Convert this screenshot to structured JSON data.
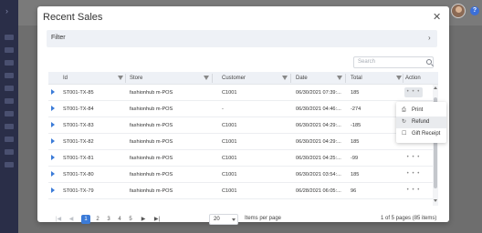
{
  "modal": {
    "title": "Recent Sales",
    "close_icon": "close-icon",
    "filter_label": "Filter",
    "search_placeholder": "Search"
  },
  "columns": [
    {
      "key": "id",
      "label": "Id"
    },
    {
      "key": "store",
      "label": "Store"
    },
    {
      "key": "customer",
      "label": "Customer"
    },
    {
      "key": "date",
      "label": "Date"
    },
    {
      "key": "total",
      "label": "Total"
    },
    {
      "key": "action",
      "label": "Action"
    }
  ],
  "rows": [
    {
      "id": "ST001-TX-85",
      "store": "fashionhub m-POS",
      "customer": "C1001",
      "date": "06/30/2021 07:39:...",
      "total": "185",
      "action": "• • •"
    },
    {
      "id": "ST001-TX-84",
      "store": "fashionhub m-POS",
      "customer": "-",
      "date": "06/30/2021 04:46:...",
      "total": "-274",
      "action": "• • •"
    },
    {
      "id": "ST001-TX-83",
      "store": "fashionhub m-POS",
      "customer": "C1001",
      "date": "06/30/2021 04:29:...",
      "total": "-185",
      "action": "• • •"
    },
    {
      "id": "ST001-TX-82",
      "store": "fashionhub m-POS",
      "customer": "C1001",
      "date": "06/30/2021 04:29:...",
      "total": "185",
      "action": "• • •"
    },
    {
      "id": "ST001-TX-81",
      "store": "fashionhub m-POS",
      "customer": "C1001",
      "date": "06/30/2021 04:25:...",
      "total": "-99",
      "action": "• • •"
    },
    {
      "id": "ST001-TX-80",
      "store": "fashionhub m-POS",
      "customer": "C1001",
      "date": "06/30/2021 03:54:...",
      "total": "185",
      "action": "• • •"
    },
    {
      "id": "ST001-TX-79",
      "store": "fashionhub m-POS",
      "customer": "C1001",
      "date": "06/28/2021 06:05:...",
      "total": "96",
      "action": "• • •"
    }
  ],
  "action_menu": [
    {
      "icon": "print-icon",
      "glyph": "⎙",
      "label": "Print"
    },
    {
      "icon": "refund-icon",
      "glyph": "↻",
      "label": "Refund"
    },
    {
      "icon": "gift-receipt-icon",
      "glyph": "☐",
      "label": "Gift Receipt"
    }
  ],
  "pager": {
    "first": "|◀",
    "prev": "◀",
    "pages": [
      "1",
      "2",
      "3",
      "4",
      "5"
    ],
    "current_page": "1",
    "next": "▶",
    "last": "▶|",
    "page_size": "20",
    "page_size_label": "Items per page",
    "info": "1 of 5 pages (85 items)"
  },
  "header_bar": {
    "avatar": "user-avatar",
    "help_glyph": "?"
  }
}
